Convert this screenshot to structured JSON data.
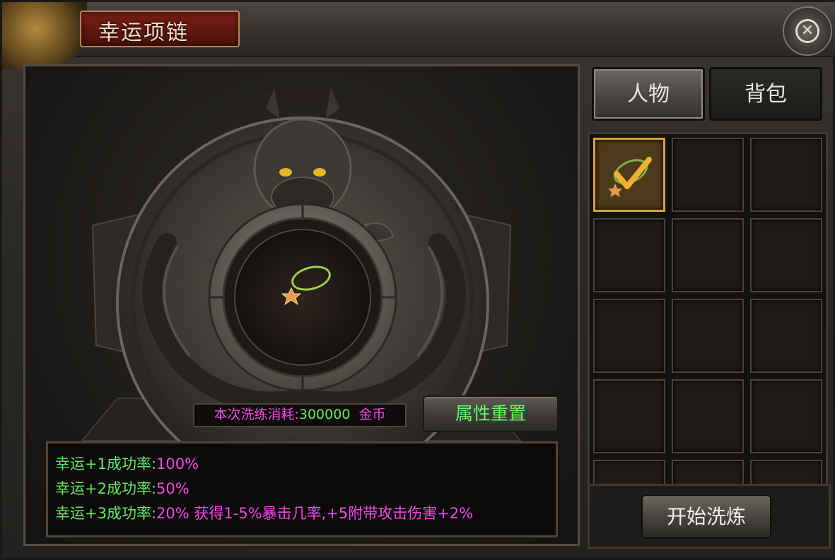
{
  "window": {
    "title": "幸运项链",
    "close_icon": "close-circle-icon"
  },
  "cost": {
    "label": "本次洗练消耗:",
    "amount": "300000",
    "currency": "金币"
  },
  "buttons": {
    "reset": "属性重置",
    "start": "开始洗炼"
  },
  "info_lines": [
    {
      "label": "幸运+1成功率:",
      "value": "100%"
    },
    {
      "label": "幸运+2成功率:",
      "value": "50%"
    },
    {
      "label": "幸运+3成功率:",
      "value": "20% 获得1-5%暴击几率,+5附带攻击伤害+2%"
    }
  ],
  "tabs": [
    {
      "label": "人物",
      "active": true
    },
    {
      "label": "背包",
      "active": false
    }
  ],
  "inventory": {
    "selected_item": "necklace-icon",
    "selected_mark": "checkmark-icon"
  },
  "colors": {
    "label_green": "#64e85c",
    "value_pink": "#f048e8",
    "selected_gold": "#d9a23a"
  }
}
